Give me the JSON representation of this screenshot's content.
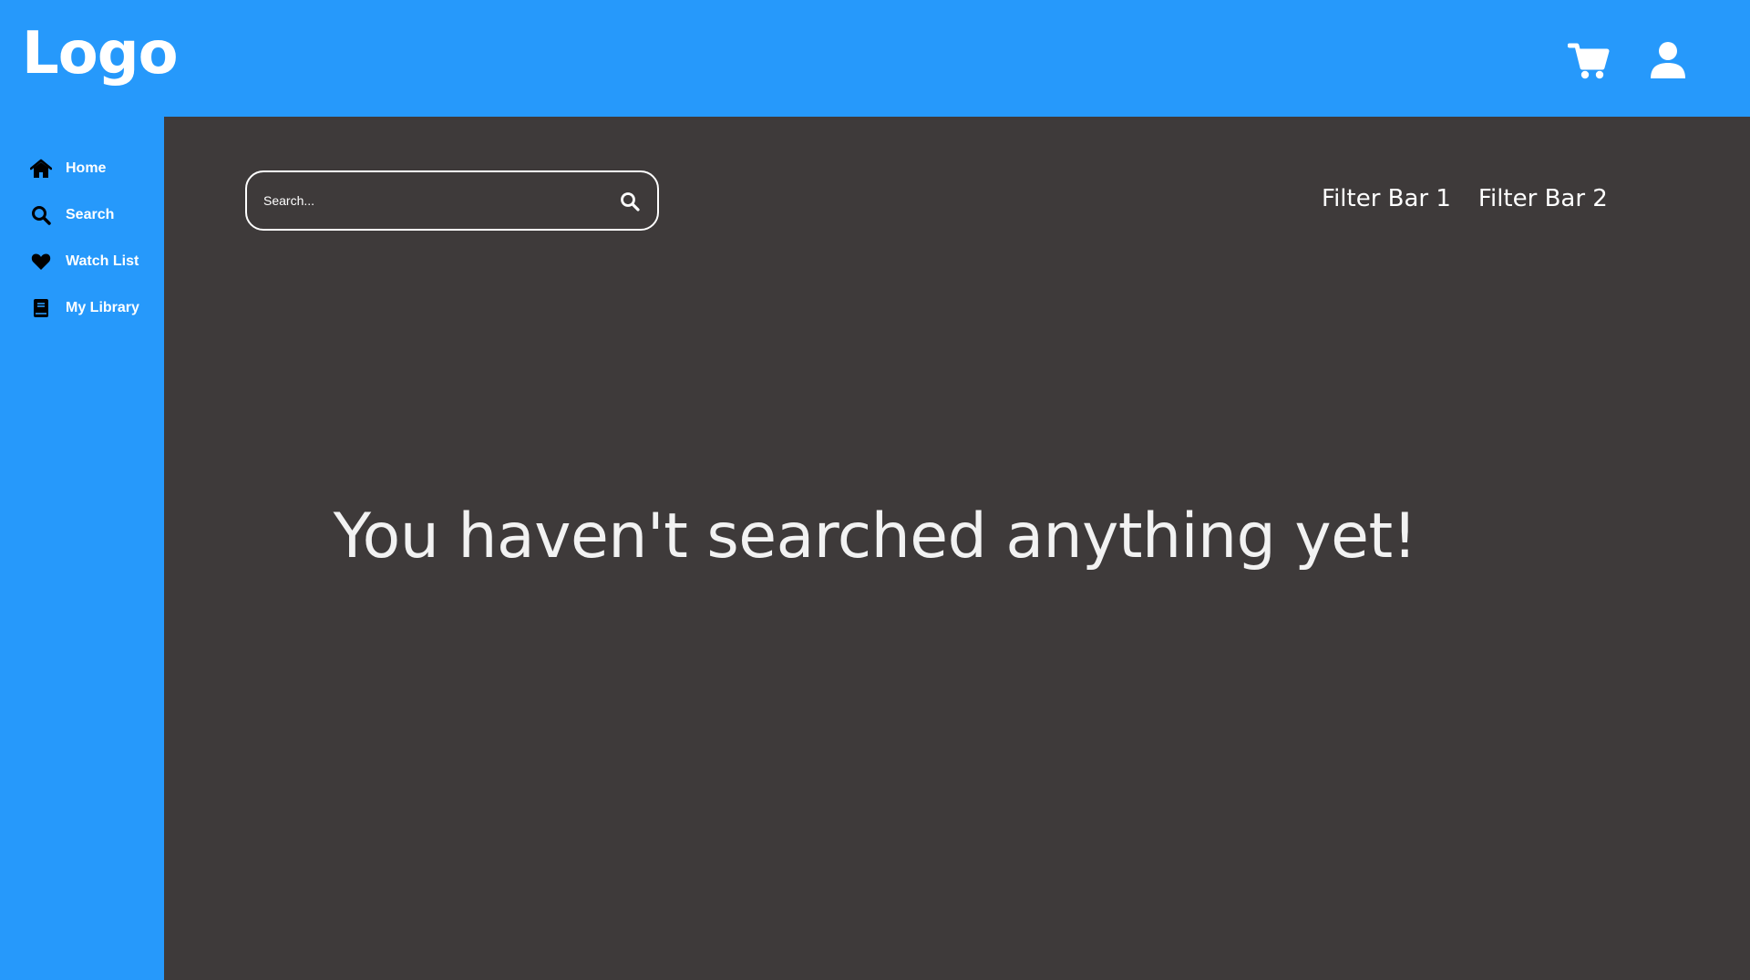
{
  "header": {
    "logo_text": "Logo",
    "icons": [
      "cart-icon",
      "user-icon"
    ]
  },
  "sidebar": {
    "items": [
      {
        "label": "Home",
        "icon": "home-icon"
      },
      {
        "label": "Search",
        "icon": "search-icon"
      },
      {
        "label": "Watch List",
        "icon": "heart-icon"
      },
      {
        "label": "My Library",
        "icon": "book-icon"
      }
    ]
  },
  "main": {
    "search": {
      "placeholder": "Search...",
      "value": ""
    },
    "filters": [
      "Filter Bar 1",
      "Filter Bar 2"
    ],
    "empty_message": "You haven't searched anything yet!"
  },
  "colors": {
    "brand_blue": "#2699fb",
    "main_background": "#3e3a3a",
    "text_light": "#ffffff"
  }
}
